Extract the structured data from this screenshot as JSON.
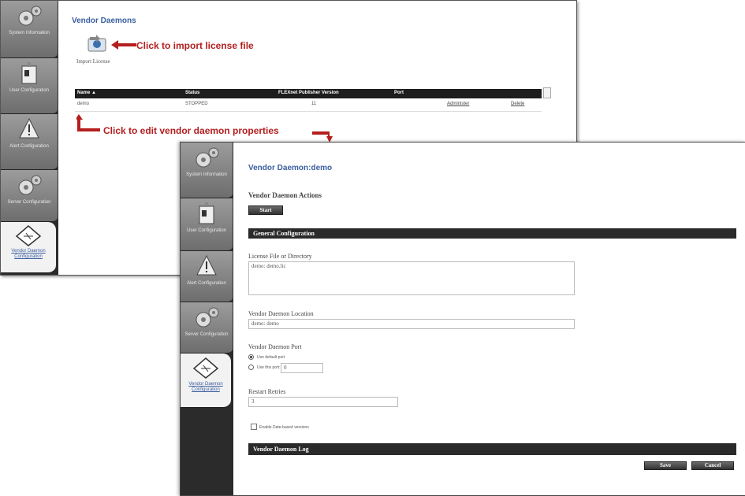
{
  "window_back": {
    "title": "Vendor Daemons",
    "import_label": "Import License",
    "annotation_import": "Click to import license file",
    "annotation_edit": "Click to edit vendor daemon properties",
    "table": {
      "headers": [
        "Name ▲",
        "Status",
        "FLEXnet Publisher Version",
        "Port"
      ],
      "rows": [
        {
          "name": "demo",
          "status": "STOPPED",
          "version": "11",
          "port": "",
          "administer": "Administer",
          "delete": "Delete"
        }
      ]
    }
  },
  "sidebar": {
    "items": [
      {
        "label": "System Information",
        "icon": "gears-icon"
      },
      {
        "label": "User Configuration",
        "icon": "id-badge-icon"
      },
      {
        "label": "Alert Configuration",
        "icon": "warning-icon"
      },
      {
        "label": "Server Configuration",
        "icon": "gears-icon"
      },
      {
        "label": "Vendor Daemon Configuration",
        "icon": "license-card-icon",
        "active": true
      }
    ]
  },
  "window_front": {
    "title": "Vendor Daemon:demo",
    "actions_heading": "Vendor Daemon Actions",
    "start_label": "Start",
    "general_section": "General Configuration",
    "license_label": "License File or Directory",
    "license_value": "demo: demo.lic",
    "location_label": "Vendor Daemon Location",
    "location_value": "demo: demo",
    "port_label": "Vendor Daemon Port",
    "use_default": "Use default port",
    "use_this": "Use this port:",
    "port_value": "0",
    "restart_label": "Restart Retries",
    "restart_value": "3",
    "enable_label": "Enable Date-based versions",
    "log_section": "Vendor Daemon Log",
    "save_label": "Save",
    "cancel_label": "Cancel"
  },
  "colors": {
    "annotation": "#b41e1e",
    "title": "#3a5fa0",
    "sidebar": "#2b2b2b"
  }
}
